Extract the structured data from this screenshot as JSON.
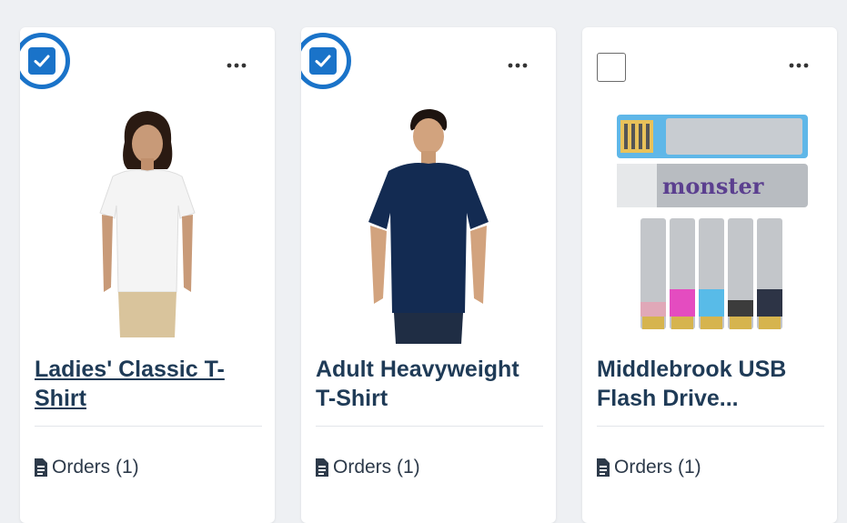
{
  "colors": {
    "accent": "#1a73c9",
    "title": "#1f3b57",
    "page_bg": "#eef0f3"
  },
  "products": [
    {
      "title": "Ladies' Classic T-Shirt",
      "selected": true,
      "is_link": true,
      "image": "woman-white-tshirt",
      "orders_label": "Orders (1)",
      "more_icon": "ellipsis-icon"
    },
    {
      "title": "Adult Heavyweight T-Shirt",
      "selected": true,
      "is_link": false,
      "image": "man-navy-tshirt",
      "orders_label": "Orders (1)",
      "more_icon": "ellipsis-icon"
    },
    {
      "title": "Middlebrook USB Flash Drive...",
      "selected": false,
      "is_link": false,
      "image": "usb-flash-drives",
      "image_text": "monster",
      "orders_label": "Orders (1)",
      "more_icon": "ellipsis-icon"
    }
  ]
}
